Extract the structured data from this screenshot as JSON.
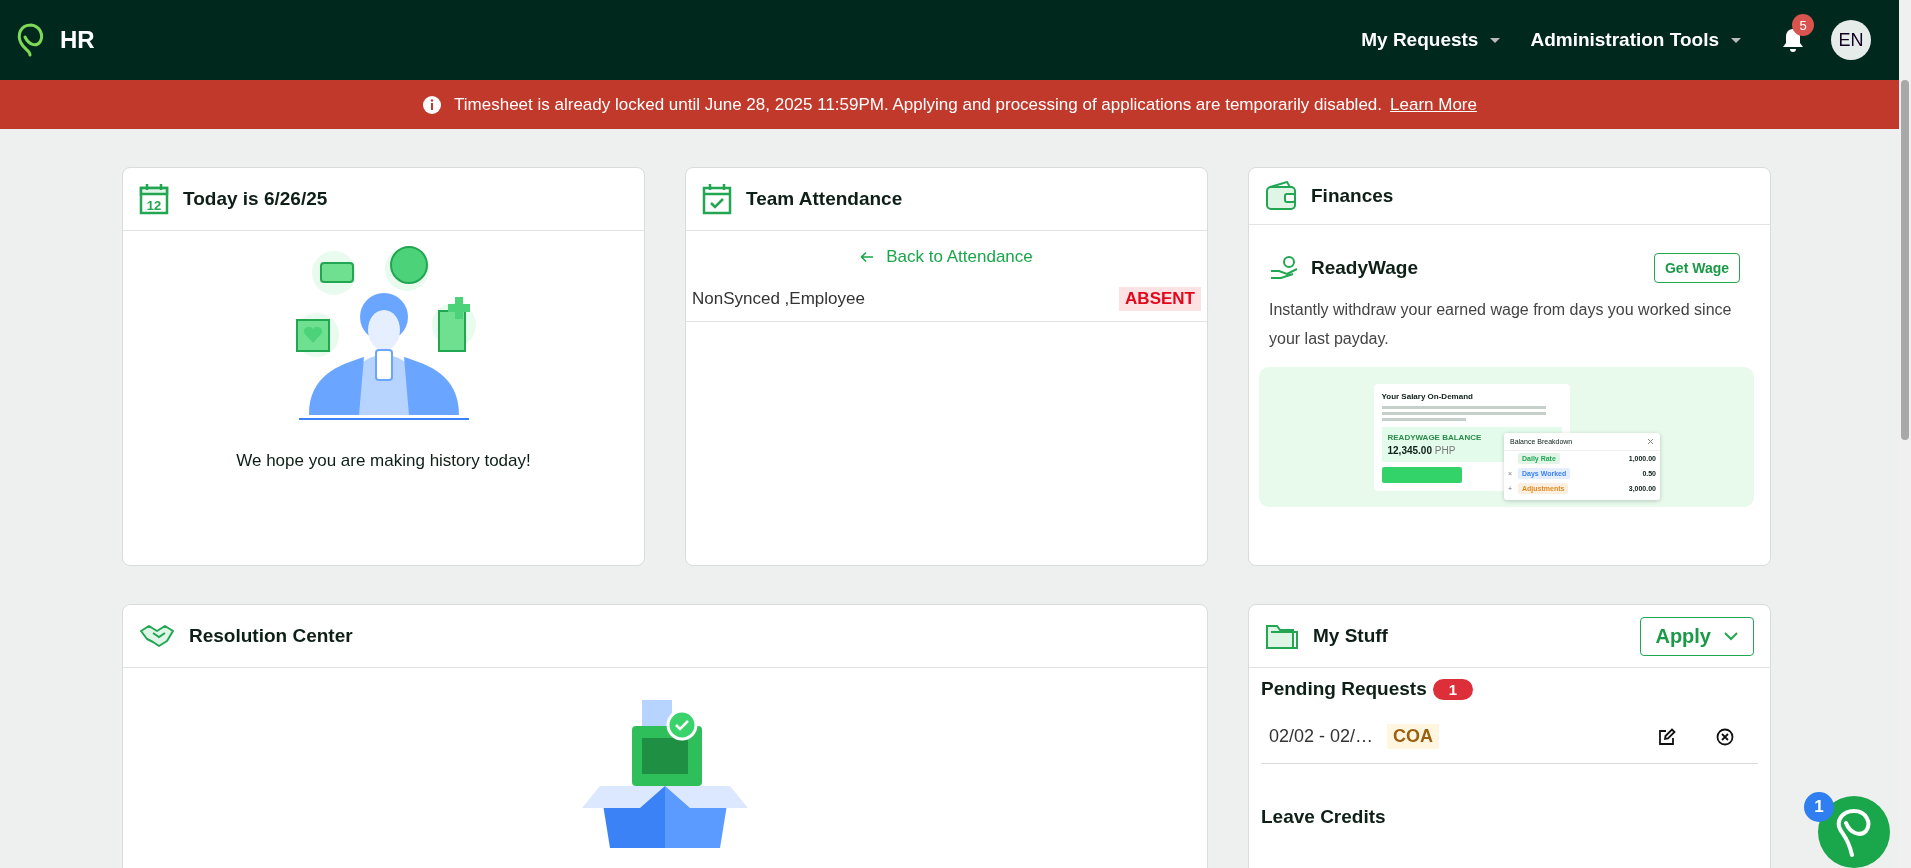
{
  "header": {
    "logo": "HR",
    "menus": [
      {
        "label": "My Requests"
      },
      {
        "label": "Administration Tools"
      }
    ],
    "notification_count": "5",
    "avatar": "EN"
  },
  "banner": {
    "message": "Timesheet is already locked until June 28, 2025 11:59PM. Applying and processing of applications are temporarily disabled.",
    "link": "Learn More"
  },
  "today_card": {
    "title": "Today is 6/26/25",
    "calendar_day": "12",
    "message": "We hope you are making history today!"
  },
  "team_attendance": {
    "title": "Team Attendance",
    "back_link": "Back to Attendance",
    "rows": [
      {
        "name": "NonSynced ,Employee",
        "status": "ABSENT"
      }
    ]
  },
  "finances": {
    "title": "Finances",
    "product": "ReadyWage",
    "button": "Get Wage",
    "description": "Instantly withdraw your earned wage from days you worked since your last payday.",
    "preview": {
      "title": "Your Salary On-Demand",
      "balance_label": "READYWAGE BALANCE",
      "amount": "12,345.00",
      "currency": "PHP",
      "breakdown_title": "Balance Breakdown",
      "rows": [
        {
          "operator": "",
          "label": "Daily Rate",
          "value": "1,000.00",
          "color": "#22a652"
        },
        {
          "operator": "×",
          "label": "Days Worked",
          "value": "0.50",
          "color": "#3b82f6"
        },
        {
          "operator": "+",
          "label": "Adjustments",
          "value": "3,000.00",
          "color": "#e08a1e"
        }
      ]
    }
  },
  "resolution_center": {
    "title": "Resolution Center"
  },
  "my_stuff": {
    "title": "My Stuff",
    "apply_button": "Apply",
    "pending_title": "Pending Requests",
    "pending_count": "1",
    "requests": [
      {
        "dates": "02/02 - 02/…",
        "type": "COA"
      }
    ],
    "leave_title": "Leave Credits"
  },
  "chat": {
    "badge": "1"
  }
}
